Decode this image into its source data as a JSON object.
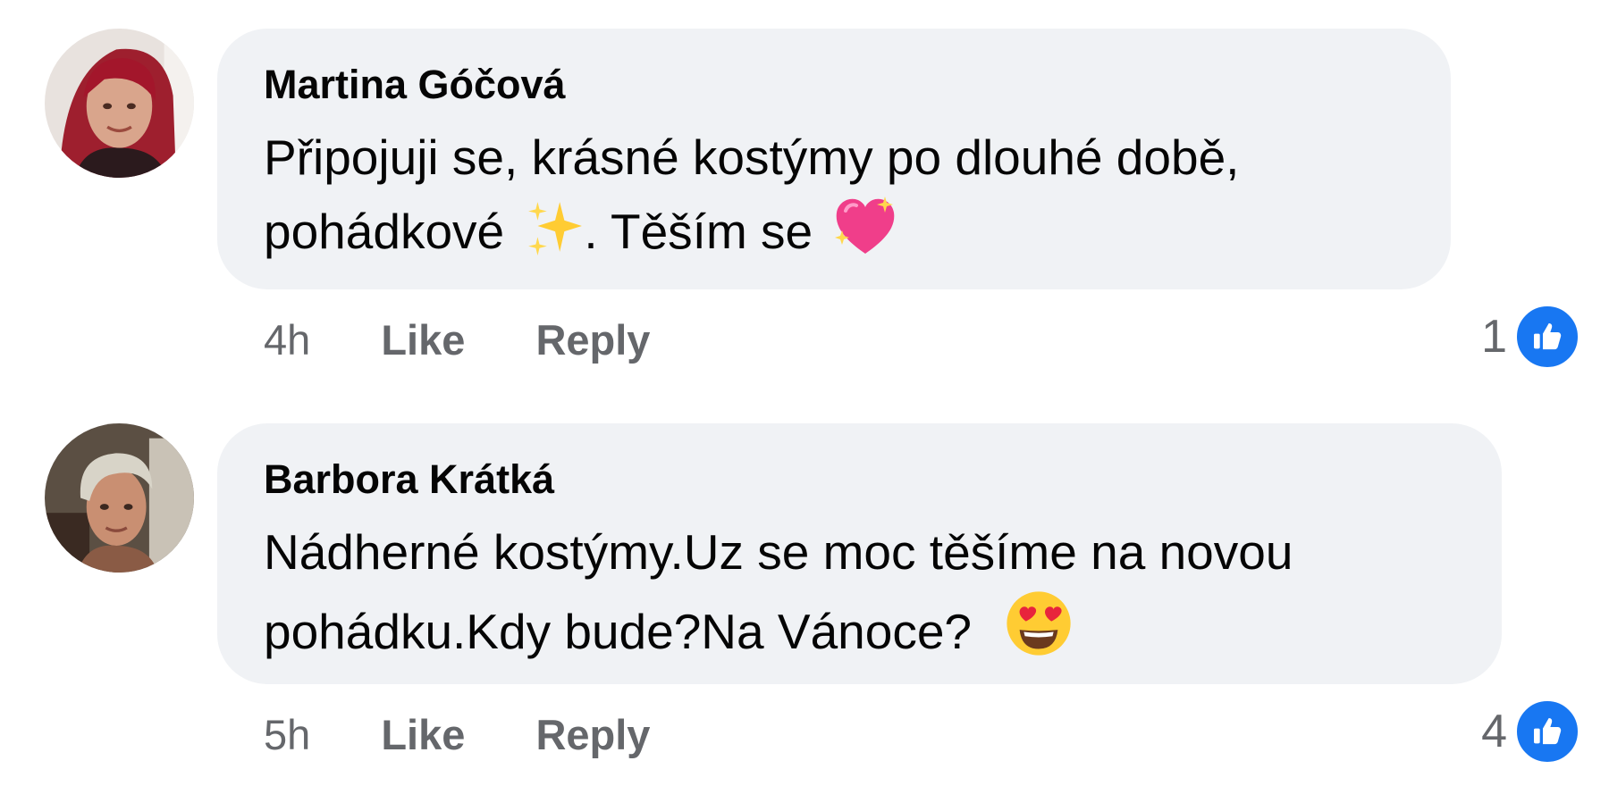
{
  "comments": [
    {
      "author": "Martina Góčová",
      "text_line1": "Připojuji se, krásné kostýmy po dlouhé době,",
      "text_line2_a": "pohádkové",
      "text_line2_b": ". Těším se",
      "emoji_1": "sparkles-emoji",
      "emoji_2": "sparkling-heart-emoji",
      "time": "4h",
      "like_label": "Like",
      "reply_label": "Reply",
      "reaction_count": "1",
      "reaction_icon": "like-icon"
    },
    {
      "author": "Barbora Krátká",
      "text_line1": "Nádherné kostýmy.Uz se moc těšíme na novou",
      "text_line2": "pohádku.Kdy bude?Na Vánoce?",
      "emoji_1": "heart-eyes-emoji",
      "time": "5h",
      "like_label": "Like",
      "reply_label": "Reply",
      "reaction_count": "4",
      "reaction_icon": "like-icon"
    }
  ],
  "colors": {
    "bubble": "#f0f2f5",
    "text": "#050505",
    "meta": "#65676b",
    "like_blue": "#1877f2"
  }
}
